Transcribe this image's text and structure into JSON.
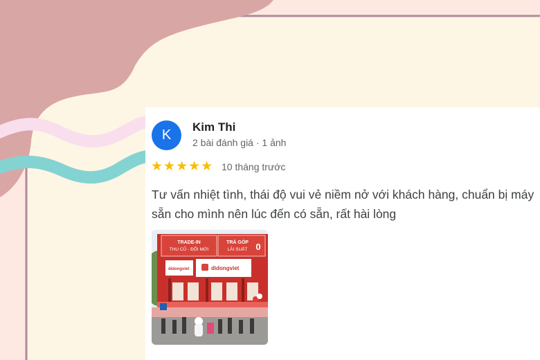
{
  "review": {
    "avatar_letter": "K",
    "author": "Kim Thi",
    "author_meta": "2 bài đánh giá · 1 ảnh",
    "rating": 5,
    "rating_stars": "★★★★★",
    "time_ago": "10 tháng trước",
    "text": "Tư vấn nhiệt tình, thái độ vui vẻ niềm nở với khách hàng, chuẩn bị máy sẵn cho mình nên lúc đến có sẵn, rất hài lòng"
  },
  "photo": {
    "sign_left_line1": "TRADE-IN",
    "sign_left_line2": "THU CŨ - ĐỔI MỚI",
    "sign_right_line1": "TRẢ GÓP",
    "sign_right_line2": "LÃI SUẤT",
    "sign_right_number": "0",
    "store_brand": "didongviet",
    "side_brand": "didongviet"
  },
  "colors": {
    "avatar": "#1a73e8",
    "star": "#fbbc04",
    "background_pink": "#fde9e2",
    "blob_rose": "#d9a6a6",
    "panel_cream": "#fef6e4",
    "panel_border": "#b0899d",
    "wave_pink": "#f9dfee",
    "wave_teal": "#84d3d3"
  }
}
